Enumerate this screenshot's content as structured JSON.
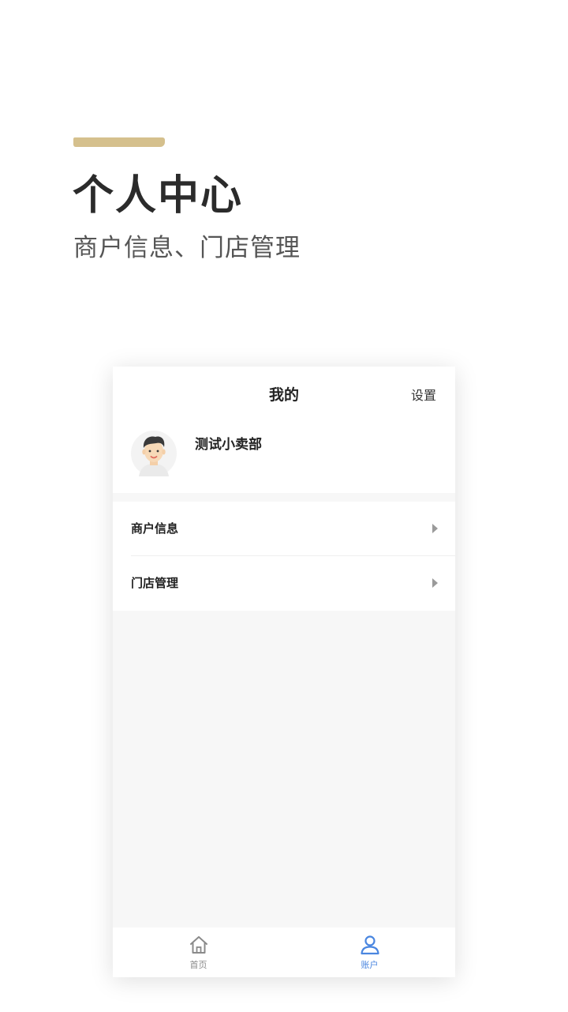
{
  "promo": {
    "title": "个人中心",
    "subtitle": "商户信息、门店管理"
  },
  "nav": {
    "title": "我的",
    "settings_label": "设置"
  },
  "profile": {
    "shop_name": "测试小卖部"
  },
  "menu": {
    "items": [
      {
        "label": "商户信息"
      },
      {
        "label": "门店管理"
      }
    ]
  },
  "tabbar": {
    "items": [
      {
        "label": "首页",
        "icon": "home-icon",
        "active": false
      },
      {
        "label": "账户",
        "icon": "user-icon",
        "active": true
      }
    ]
  },
  "colors": {
    "accent": "#d5c08d",
    "active_tab": "#4a86e0",
    "inactive_tab": "#8a8a8a"
  }
}
